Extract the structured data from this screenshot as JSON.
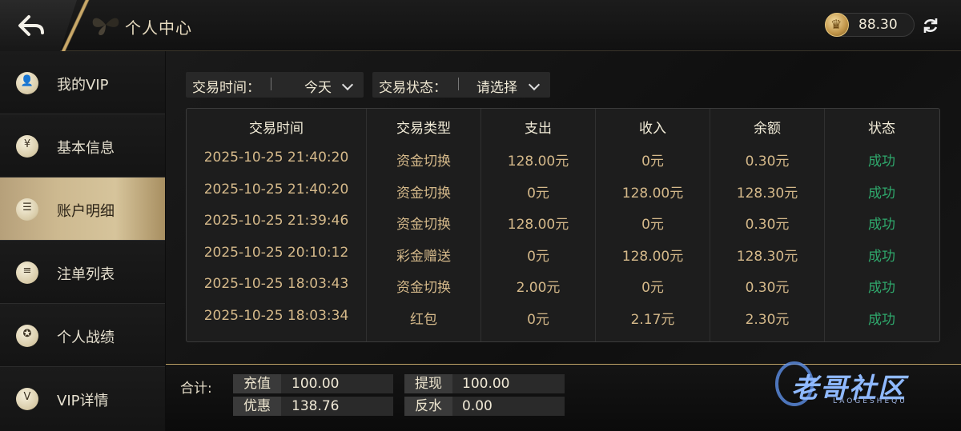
{
  "header": {
    "title": "个人中心",
    "balance": "88.30"
  },
  "sidebar": {
    "items": [
      {
        "label": "我的VIP",
        "icon": "user-icon",
        "glyph": "👤",
        "active": false
      },
      {
        "label": "基本信息",
        "icon": "info-card-icon",
        "glyph": "¥",
        "active": false
      },
      {
        "label": "账户明细",
        "icon": "ledger-icon",
        "glyph": "☰",
        "active": true
      },
      {
        "label": "注单列表",
        "icon": "list-icon",
        "glyph": "≡",
        "active": false
      },
      {
        "label": "个人战绩",
        "icon": "medal-icon",
        "glyph": "✪",
        "active": false
      },
      {
        "label": "VIP详情",
        "icon": "vip-badge-icon",
        "glyph": "V",
        "active": false
      }
    ]
  },
  "filters": {
    "time_label": "交易时间：",
    "time_value": "今天",
    "status_label": "交易状态：",
    "status_value": "请选择"
  },
  "table": {
    "headers": [
      "交易时间",
      "交易类型",
      "支出",
      "收入",
      "余额",
      "状态"
    ],
    "rows": [
      [
        "2025-10-25 21:40:20",
        "资金切换",
        "128.00元",
        "0元",
        "0.30元",
        "成功"
      ],
      [
        "2025-10-25 21:40:20",
        "资金切换",
        "0元",
        "128.00元",
        "128.30元",
        "成功"
      ],
      [
        "2025-10-25 21:39:46",
        "资金切换",
        "128.00元",
        "0元",
        "0.30元",
        "成功"
      ],
      [
        "2025-10-25 20:10:12",
        "彩金赠送",
        "0元",
        "128.00元",
        "128.30元",
        "成功"
      ],
      [
        "2025-10-25 18:03:43",
        "资金切换",
        "2.00元",
        "0元",
        "0.30元",
        "成功"
      ],
      [
        "2025-10-25 18:03:34",
        "红包",
        "0元",
        "2.17元",
        "2.30元",
        "成功"
      ]
    ]
  },
  "summary": {
    "label": "合计:",
    "recharge_label": "充值",
    "recharge_value": "100.00",
    "withdraw_label": "提现",
    "withdraw_value": "100.00",
    "discount_label": "优惠",
    "discount_value": "138.76",
    "rebate_label": "反水",
    "rebate_value": "0.00"
  },
  "watermark": {
    "title": "老哥社区",
    "subtitle": "LAOGESHEQU"
  },
  "colors": {
    "gold": "#c9a868",
    "success": "#2fa86c",
    "amount": "#d5b98a"
  }
}
